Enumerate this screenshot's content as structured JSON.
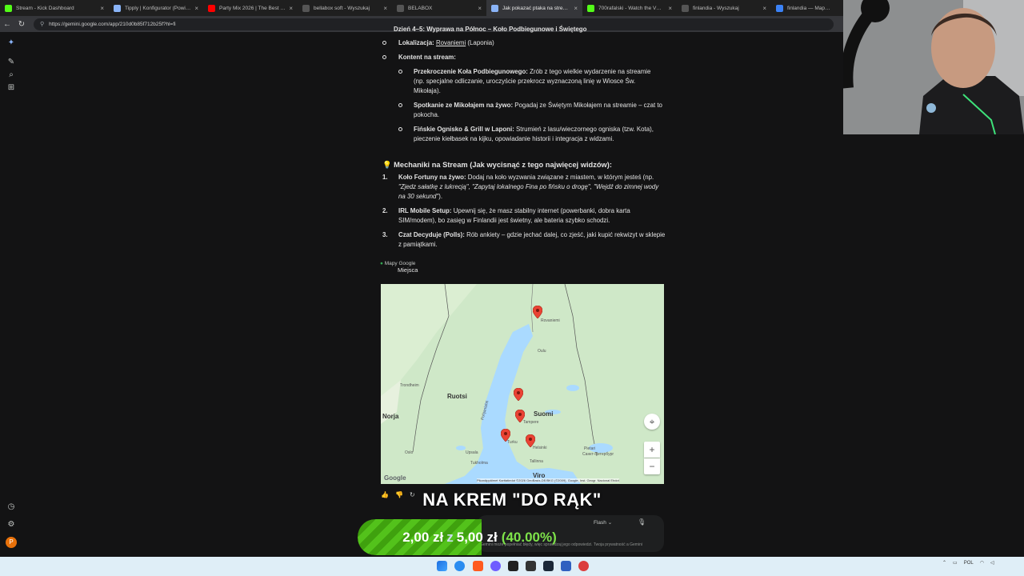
{
  "browser": {
    "tabs": [
      {
        "title": "Stream - Kick Dashboard",
        "color": "#53fc18"
      },
      {
        "title": "Tipply | Konfigurator (Powiadomienia)",
        "color": "#8ab4f8"
      },
      {
        "title": "Party Mix 2026 | The Best Remixes",
        "color": "#ff0000"
      },
      {
        "title": "bellabox soft - Wyszukaj",
        "color": "#6b6b6b"
      },
      {
        "title": "BELABOX",
        "color": "#6b6b6b"
      },
      {
        "title": "Jak pokazać ptaka na streamie - Gemini",
        "color": "#8ab4f8"
      },
      {
        "title": "700rafalski - Watch the VOD on Kick",
        "color": "#53fc18"
      },
      {
        "title": "finlandia - Wyszukaj",
        "color": "#6b6b6b"
      },
      {
        "title": "finlandia — Mapy Bing",
        "color": "#3b82f6"
      }
    ],
    "active_tab_index": 5,
    "url": "https://gemini.google.com/app/210d0b85f712b25f?hl=fi"
  },
  "content": {
    "cut_heading": "Dzień 4–5: Wyprawa na Północ – Koło Podbiegunowe i Świętego",
    "lokalizacja_label": "Lokalizacja:",
    "lokalizacja_link": "Rovaniemi",
    "lokalizacja_rest": " (Laponia)",
    "kontent_label": "Kontent na stream:",
    "subitems": [
      {
        "bold": "Przekroczenie Koła Podbiegunowego:",
        "text": " Zrób z tego wielkie wydarzenie na streamie (np. specjalne odliczanie, uroczyście przekrocz wyznaczoną linię w Wiosce Św. Mikołaja)."
      },
      {
        "bold": "Spotkanie ze Mikołajem na żywo:",
        "text": " Pogadaj ze Świętym Mikołajem na streamie – czat to pokocha."
      },
      {
        "bold": "Fińskie Ognisko & Grill w Laponi:",
        "text": " Strumień z lasu/wieczornego ogniska (tzw. Kota), pieczenie kiełbasek na kijku, opowiadanie historii i integracja z widzami."
      }
    ],
    "mechanics_heading": "Mechaniki na Stream (Jak wycisnąć z tego najwięcej widzów):",
    "mechanics": [
      {
        "num": "1.",
        "bold": "Koło Fortuny na żywo:",
        "text": " Dodaj na koło wyzwania związane z miastem, w którym jesteś (np. ",
        "italic": "\"Zjedz sałatkę z lukrecją\", \"Zapytaj lokalnego Fina po fińsku o drogę\", \"Wejdź do zimnej wody na 30 sekund\"",
        "tail": ")."
      },
      {
        "num": "2.",
        "bold": "IRL Mobile Setup:",
        "text": " Upewnij się, że masz stabilny internet (powerbanki, dobra karta SIM/modem), bo zasięg w Finlandii jest świetny, ale bateria szybko schodzi.",
        "italic": "",
        "tail": ""
      },
      {
        "num": "3.",
        "bold": "Czat Decyduje (Polls):",
        "text": " Rób ankiety – gdzie jechać dalej, co zjeść, jaki kupić rekwizyt w sklepie z pamiątkami.",
        "italic": "",
        "tail": ""
      }
    ],
    "maps_source": "Mapy Google",
    "maps_subtitle": "Miejsca"
  },
  "map": {
    "labels": {
      "ruotsi": "Ruotsi",
      "suomi": "Suomi",
      "norja": "Norja",
      "viro": "Viro",
      "rovaniemi": "Rovaniemi",
      "oulu": "Oulu",
      "tampere": "Tampere",
      "turku": "Turku",
      "helsinki": "Helsinki",
      "tukholma": "Tukholma",
      "tallinna": "Tallinna",
      "pietari": "Pietari",
      "pietari_ru": "Санкт-Петербург",
      "trondheim": "Trondheim",
      "oslo": "Oslo",
      "upsala": "Upsala",
      "bottnian": "Pohjanlahti",
      "google": "Google",
      "attribution": "Pikanäppäimet   Karttatiedot ©2026 GeoBasis-DE/BKG (©2009), Google, Inst. Geogr. Nacional   Ehdot"
    },
    "zoom_in": "+",
    "zoom_out": "−"
  },
  "overlays": {
    "banner": "NA KREM \"DO RĄK\"",
    "donation_from": "2,00 zł",
    "donation_z": "z",
    "donation_to": "5,00 zł",
    "donation_pct": "(40.00%)",
    "model_label": "Flash",
    "disclaimer": "Gemini może popełniać błędy, więc sprawdzaj jego odpowiedzi. Twoja prywatność a Gemini"
  },
  "taskbar": {
    "lang": "POL"
  }
}
